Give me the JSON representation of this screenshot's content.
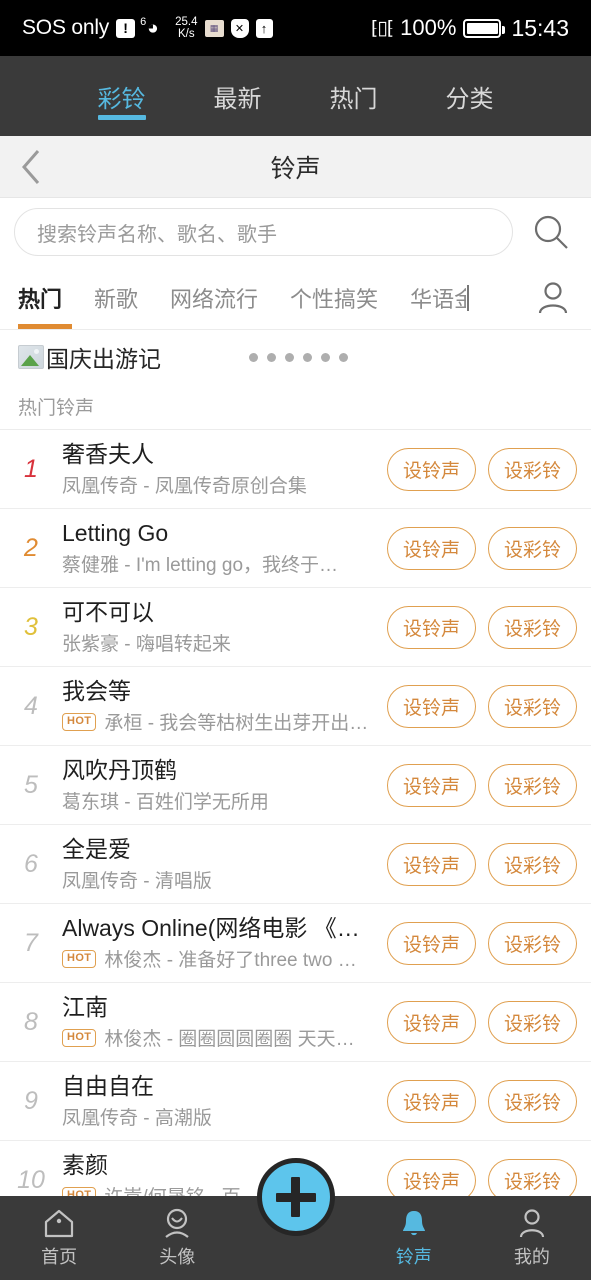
{
  "statusbar": {
    "carrier": "SOS only",
    "alert_icon": "!",
    "wifi_sup": "6",
    "net_speed_value": "25.4",
    "net_speed_unit": "K/s",
    "battery_percent": "100%",
    "clock": "15:43"
  },
  "top_tabs": {
    "items": [
      {
        "label": "彩铃",
        "active": true
      },
      {
        "label": "最新",
        "active": false
      },
      {
        "label": "热门",
        "active": false
      },
      {
        "label": "分类",
        "active": false
      }
    ],
    "accent_color": "#56b9e0"
  },
  "header": {
    "title": "铃声",
    "back_label": "返回"
  },
  "search": {
    "placeholder": "搜索铃声名称、歌名、歌手",
    "value": ""
  },
  "category_tabs": {
    "items": [
      {
        "label": "热门",
        "active": true
      },
      {
        "label": "新歌",
        "active": false
      },
      {
        "label": "网络流行",
        "active": false
      },
      {
        "label": "个性搞笑",
        "active": false
      },
      {
        "label": "华语金",
        "active": false,
        "clipped": true
      }
    ],
    "accent_color": "#e08b32"
  },
  "banner": {
    "title": "国庆出游记",
    "dot_count": 6
  },
  "section": {
    "label": "热门铃声"
  },
  "list": {
    "button_set_ringtone": "设铃声",
    "button_set_crbt": "设彩铃",
    "hot_badge": "HOT",
    "rows": [
      {
        "rank": "1",
        "title": "奢香夫人",
        "artist": "凤凰传奇 - 凤凰传奇原创合集",
        "hot": false
      },
      {
        "rank": "2",
        "title": "Letting Go",
        "artist": "蔡健雅 - I'm letting go，我终于…",
        "hot": false
      },
      {
        "rank": "3",
        "title": "可不可以",
        "artist": "张紫豪 - 嗨唱转起来",
        "hot": false
      },
      {
        "rank": "4",
        "title": "我会等",
        "artist": "承桓 - 我会等枯树生出芽开出…",
        "hot": true
      },
      {
        "rank": "5",
        "title": "风吹丹顶鹤",
        "artist": "葛东琪 - 百姓们学无所用",
        "hot": false
      },
      {
        "rank": "6",
        "title": "全是爱",
        "artist": "凤凰传奇 - 清唱版",
        "hot": false
      },
      {
        "rank": "7",
        "title": "Always Online(网络电影 《…",
        "artist": "林俊杰 - 准备好了three two …",
        "hot": true
      },
      {
        "rank": "8",
        "title": "江南",
        "artist": "林俊杰 - 圈圈圆圆圈圈 天天…",
        "hot": true
      },
      {
        "rank": "9",
        "title": "自由自在",
        "artist": "凤凰传奇 - 高潮版",
        "hot": false
      },
      {
        "rank": "10",
        "title": "素颜",
        "artist": "许嵩/何晟铭 - 百…的校",
        "hot": true
      }
    ]
  },
  "bottom_nav": {
    "items": [
      {
        "label": "首页",
        "icon": "home-icon",
        "active": false
      },
      {
        "label": "头像",
        "icon": "avatar-icon",
        "active": false
      },
      {
        "label": "铃声",
        "icon": "bell-icon",
        "active": true
      },
      {
        "label": "我的",
        "icon": "person-icon",
        "active": false
      }
    ],
    "fab_label": "+",
    "accent_color": "#56b9e0"
  }
}
